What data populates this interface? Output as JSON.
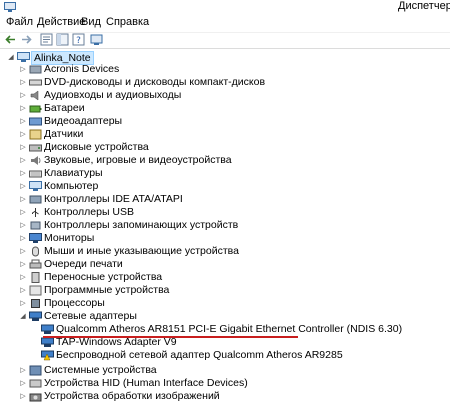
{
  "window": {
    "title": "Диспетчер"
  },
  "menu": [
    {
      "label": "Файл"
    },
    {
      "label": "Действие"
    },
    {
      "label": "Вид"
    },
    {
      "label": "Справка"
    }
  ],
  "tree": {
    "root": "Alinka_Note",
    "categories": [
      "Acronis Devices",
      "DVD-дисководы и дисководы компакт-дисков",
      "Аудиовходы и аудиовыходы",
      "Батареи",
      "Видеоадаптеры",
      "Датчики",
      "Дисковые устройства",
      "Звуковые, игровые и видеоустройства",
      "Клавиатуры",
      "Компьютер",
      "Контроллеры IDE ATA/ATAPI",
      "Контроллеры USB",
      "Контроллеры запоминающих устройств",
      "Мониторы",
      "Мыши и иные указывающие устройства",
      "Очереди печати",
      "Переносные устройства",
      "Программные устройства",
      "Процессоры",
      "Сетевые адаптеры"
    ],
    "network_adapters": [
      "Qualcomm Atheros AR8151 PCI-E Gigabit Ethernet Controller (NDIS 6.30)",
      "TAP-Windows Adapter V9",
      "Беспроводной сетевой адаптер Qualcomm Atheros AR9285"
    ],
    "after": [
      "Системные устройства",
      "Устройства HID (Human Interface Devices)",
      "Устройства обработки изображений"
    ]
  },
  "colors": {
    "accent_underline": "#c81e1e",
    "selection": "#cce8ff"
  }
}
